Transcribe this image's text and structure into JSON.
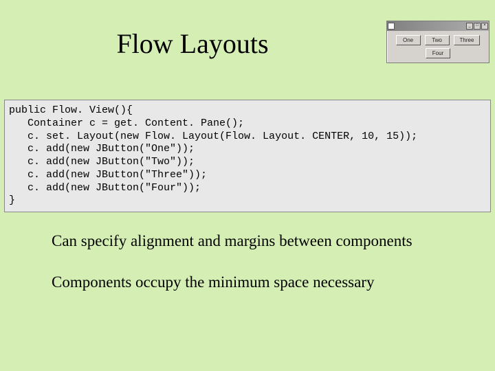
{
  "title": "Flow Layouts",
  "demo": {
    "icon_name": "java-icon",
    "titlebar_buttons": [
      "min",
      "max",
      "close"
    ],
    "buttons": [
      "One",
      "Two",
      "Three",
      "Four"
    ]
  },
  "code": {
    "lines": [
      "public Flow. View(){",
      "   Container c = get. Content. Pane();",
      "   c. set. Layout(new Flow. Layout(Flow. Layout. CENTER, 10, 15));",
      "   c. add(new JButton(\"One\"));",
      "   c. add(new JButton(\"Two\"));",
      "   c. add(new JButton(\"Three\"));",
      "   c. add(new JButton(\"Four\"));",
      "}"
    ]
  },
  "body": {
    "line1": "Can specify alignment and margins between components",
    "line2": "Components occupy the minimum space necessary"
  }
}
